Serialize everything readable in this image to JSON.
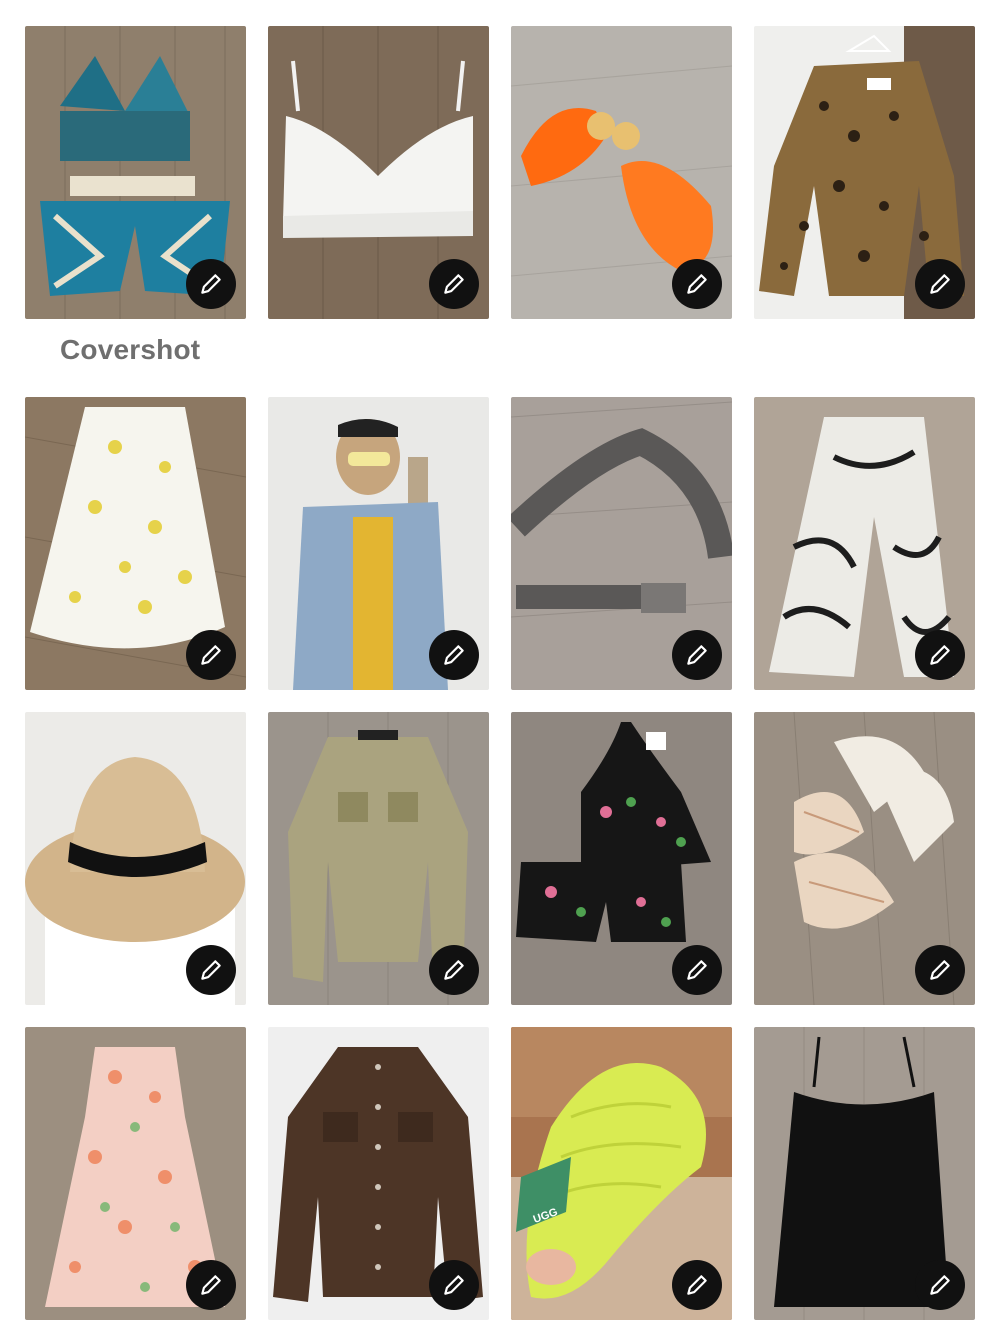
{
  "section": {
    "label": "Covershot"
  },
  "edit_icon": "pencil-icon",
  "tiles": [
    {
      "name": "crochet-set",
      "brand_text": ""
    },
    {
      "name": "lace-bralette",
      "brand_text": ""
    },
    {
      "name": "orange-jelly-sandals",
      "brand_text": ""
    },
    {
      "name": "leopard-jacket",
      "brand_text": ""
    },
    {
      "name": "floral-maxi-skirt",
      "brand_text": ""
    },
    {
      "name": "denim-shirt-jacket",
      "brand_text": ""
    },
    {
      "name": "metallic-belt",
      "brand_text": ""
    },
    {
      "name": "zebra-trousers",
      "brand_text": ""
    },
    {
      "name": "straw-hat",
      "brand_text": ""
    },
    {
      "name": "gold-denim-jacket",
      "brand_text": ""
    },
    {
      "name": "floral-pajama-set",
      "brand_text": ""
    },
    {
      "name": "bow-heel-sandals",
      "brand_text": ""
    },
    {
      "name": "floral-tiered-dress",
      "brand_text": ""
    },
    {
      "name": "brown-denim-jacket",
      "brand_text": ""
    },
    {
      "name": "ugg-fuzzy-slipper",
      "brand_text": "UGG"
    },
    {
      "name": "black-lace-dress",
      "brand_text": ""
    }
  ],
  "colors": {
    "button_bg": "#111111",
    "label_gray": "#6f6f6f",
    "floor": "#8a7a66"
  }
}
